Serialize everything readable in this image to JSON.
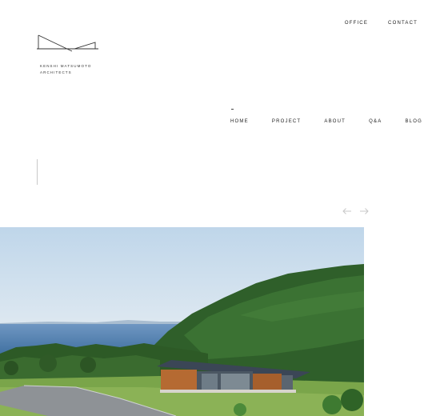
{
  "brand": {
    "line1": "KENSHI MATSUMOTO",
    "line2": "ARCHITECTS",
    "logo_icon": "architect-roofline-logo"
  },
  "top_nav": {
    "office": "OFFICE",
    "contact": "CONTACT"
  },
  "main_nav": {
    "items": [
      "HOME",
      "PROJECT",
      "ABOUT",
      "Q&A",
      "BLOG"
    ],
    "active": "HOME"
  },
  "slider": {
    "prev_icon": "arrow-left-icon",
    "next_icon": "arrow-right-icon"
  },
  "hero": {
    "image": "house-on-hillside-by-sea-photo"
  },
  "colors": {
    "text": "#222222",
    "arrow": "#c8c8c8",
    "background": "#ffffff"
  }
}
